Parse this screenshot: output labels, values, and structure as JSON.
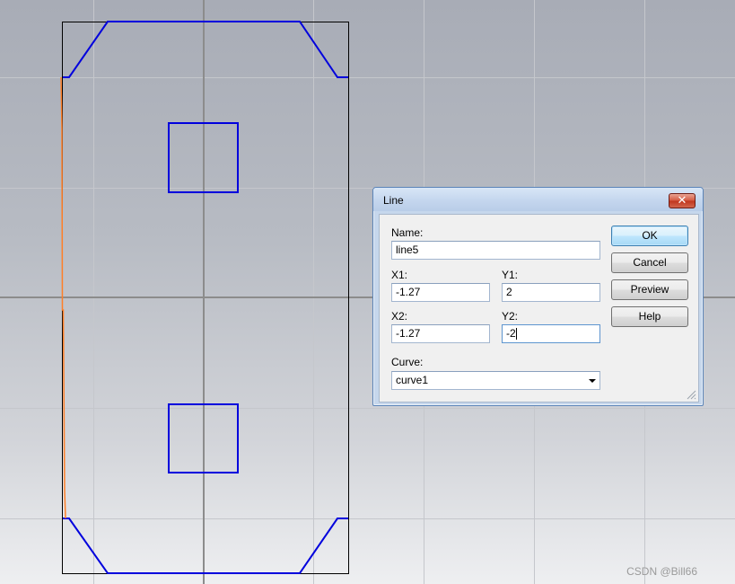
{
  "dialog": {
    "title": "Line",
    "close_glyph": "✕",
    "name_label": "Name:",
    "name_value": "line5",
    "x1_label": "X1:",
    "x1_value": "-1.27",
    "y1_label": "Y1:",
    "y1_value": "2",
    "x2_label": "X2:",
    "x2_value": "-1.27",
    "y2_label": "Y2:",
    "y2_value": "-2",
    "curve_label": "Curve:",
    "curve_value": "curve1",
    "buttons": {
      "ok": "OK",
      "cancel": "Cancel",
      "preview": "Preview",
      "help": "Help"
    }
  },
  "watermark": "CSDN @Bill66",
  "colors": {
    "outline": "#000000",
    "pads": "#0000dd",
    "preview_line": "#ff7f27",
    "grid_major": "#8f8f8f",
    "grid_minor": "#c7c9ce"
  }
}
